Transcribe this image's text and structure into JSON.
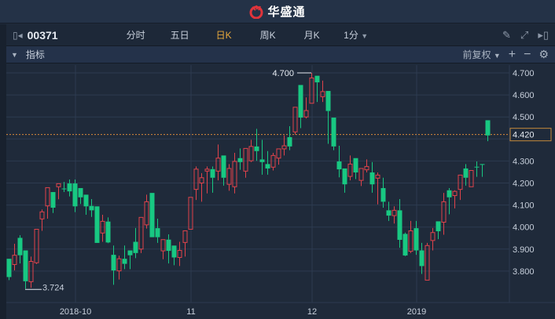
{
  "app": {
    "title": "华盛通",
    "accent": "#e8a93c"
  },
  "toolbar": {
    "code": "00371",
    "tabs": [
      "分时",
      "五日",
      "日K",
      "周K",
      "月K",
      "1分"
    ],
    "active_tab": "日K"
  },
  "subbar": {
    "indicator_label": "指标",
    "adjust": "前复权"
  },
  "chart_data": {
    "type": "candlestick",
    "y_ticks": [
      "4.700",
      "4.600",
      "4.500",
      "4.300",
      "4.200",
      "4.100",
      "4.000",
      "3.900",
      "3.800"
    ],
    "ylim": [
      3.68,
      4.74
    ],
    "x_labels": [
      "2018-10",
      "11",
      "12",
      "2019"
    ],
    "x_label_index": [
      12,
      33,
      55,
      74
    ],
    "last_price": "4.420",
    "max_label": "4.700",
    "min_label": "3.724",
    "up_color": "#e0434b",
    "down_color": "#18c882",
    "ohlc": [
      [
        3.856,
        3.856,
        3.759,
        3.773
      ],
      [
        3.83,
        3.924,
        3.803,
        3.872
      ],
      [
        3.951,
        3.963,
        3.835,
        3.872
      ],
      [
        3.894,
        3.894,
        3.72,
        3.754
      ],
      [
        3.752,
        3.866,
        3.724,
        3.844
      ],
      [
        3.838,
        3.99,
        3.832,
        3.99
      ],
      [
        4.037,
        4.08,
        3.983,
        4.069
      ],
      [
        4.096,
        4.179,
        4.038,
        4.179
      ],
      [
        4.159,
        4.159,
        4.064,
        4.088
      ],
      [
        4.183,
        4.197,
        4.126,
        4.197
      ],
      [
        4.175,
        4.205,
        4.159,
        4.172
      ],
      [
        4.198,
        4.216,
        4.139,
        4.162
      ],
      [
        4.198,
        4.216,
        4.068,
        4.094
      ],
      [
        4.177,
        4.177,
        4.105,
        4.135
      ],
      [
        4.147,
        4.147,
        4.056,
        4.094
      ],
      [
        4.096,
        4.127,
        4.046,
        4.076
      ],
      [
        4.094,
        4.094,
        3.928,
        3.928
      ],
      [
        3.973,
        4.056,
        3.933,
        4.026
      ],
      [
        4.025,
        4.044,
        3.927,
        3.93
      ],
      [
        3.874,
        3.916,
        3.738,
        3.803
      ],
      [
        3.801,
        3.87,
        3.762,
        3.856
      ],
      [
        3.856,
        3.916,
        3.809,
        3.833
      ],
      [
        3.894,
        3.894,
        3.809,
        3.872
      ],
      [
        3.933,
        3.996,
        3.859,
        3.882
      ],
      [
        3.9,
        4.044,
        3.882,
        4.044
      ],
      [
        4.01,
        4.147,
        3.993,
        4.115
      ],
      [
        4.155,
        4.155,
        3.954,
        3.954
      ],
      [
        3.995,
        4.038,
        3.928,
        3.954
      ],
      [
        3.892,
        3.943,
        3.854,
        3.943
      ],
      [
        3.943,
        3.967,
        3.835,
        3.892
      ],
      [
        3.916,
        3.916,
        3.827,
        3.862
      ],
      [
        3.862,
        3.933,
        3.823,
        3.894
      ],
      [
        3.93,
        3.983,
        3.866,
        3.983
      ],
      [
        3.99,
        4.135,
        3.99,
        4.135
      ],
      [
        4.171,
        4.275,
        4.123,
        4.263
      ],
      [
        4.2,
        4.245,
        4.115,
        4.224
      ],
      [
        4.254,
        4.275,
        4.153,
        4.263
      ],
      [
        4.263,
        4.275,
        4.156,
        4.224
      ],
      [
        4.254,
        4.375,
        4.212,
        4.313
      ],
      [
        4.325,
        4.325,
        4.188,
        4.224
      ],
      [
        4.194,
        4.286,
        4.165,
        4.266
      ],
      [
        4.183,
        4.337,
        4.153,
        4.298
      ],
      [
        4.313,
        4.357,
        4.26,
        4.295
      ],
      [
        4.254,
        4.357,
        4.224,
        4.357
      ],
      [
        4.301,
        4.396,
        4.295,
        4.366
      ],
      [
        4.366,
        4.446,
        4.301,
        4.345
      ],
      [
        4.307,
        4.396,
        4.238,
        4.295
      ],
      [
        4.286,
        4.345,
        4.238,
        4.266
      ],
      [
        4.272,
        4.337,
        4.257,
        4.325
      ],
      [
        4.313,
        4.355,
        4.283,
        4.355
      ],
      [
        4.355,
        4.416,
        4.325,
        4.369
      ],
      [
        4.408,
        4.458,
        4.349,
        4.366
      ],
      [
        4.432,
        4.544,
        4.42,
        4.544
      ],
      [
        4.645,
        4.645,
        4.449,
        4.497
      ],
      [
        4.5,
        4.589,
        4.493,
        4.529
      ],
      [
        4.562,
        4.7,
        4.562,
        4.677
      ],
      [
        4.687,
        4.687,
        4.568,
        4.657
      ],
      [
        4.592,
        4.665,
        4.568,
        4.615
      ],
      [
        4.618,
        4.618,
        4.378,
        4.527
      ],
      [
        4.497,
        4.497,
        4.349,
        4.366
      ],
      [
        4.298,
        4.369,
        4.226,
        4.262
      ],
      [
        4.266,
        4.266,
        4.156,
        4.194
      ],
      [
        4.23,
        4.325,
        4.212,
        4.286
      ],
      [
        4.313,
        4.313,
        4.218,
        4.248
      ],
      [
        4.212,
        4.266,
        4.186,
        4.266
      ],
      [
        4.26,
        4.307,
        4.248,
        4.275
      ],
      [
        4.248,
        4.295,
        4.156,
        4.194
      ],
      [
        4.222,
        4.248,
        4.103,
        4.236
      ],
      [
        4.177,
        4.224,
        4.088,
        4.115
      ],
      [
        4.076,
        4.115,
        4.028,
        4.052
      ],
      [
        4.052,
        4.094,
        4.016,
        4.076
      ],
      [
        4.076,
        4.127,
        3.906,
        3.942
      ],
      [
        3.969,
        3.975,
        3.868,
        3.871
      ],
      [
        3.89,
        4.028,
        3.882,
        3.983
      ],
      [
        3.995,
        4.028,
        3.874,
        3.894
      ],
      [
        3.894,
        3.928,
        3.787,
        3.823
      ],
      [
        3.759,
        3.928,
        3.759,
        3.916
      ],
      [
        3.939,
        3.996,
        3.894,
        3.975
      ],
      [
        4.026,
        4.026,
        3.945,
        3.981
      ],
      [
        4.022,
        4.155,
        3.965,
        4.115
      ],
      [
        4.167,
        4.177,
        4.058,
        4.135
      ],
      [
        4.143,
        4.167,
        4.085,
        4.162
      ],
      [
        4.171,
        4.236,
        4.123,
        4.236
      ],
      [
        4.266,
        4.286,
        4.188,
        4.224
      ],
      [
        4.183,
        4.257,
        4.183,
        4.257
      ],
      [
        4.274,
        4.298,
        4.228,
        4.272
      ],
      [
        4.286,
        4.286,
        4.228,
        4.284
      ],
      [
        4.485,
        4.485,
        4.39,
        4.416
      ]
    ]
  }
}
